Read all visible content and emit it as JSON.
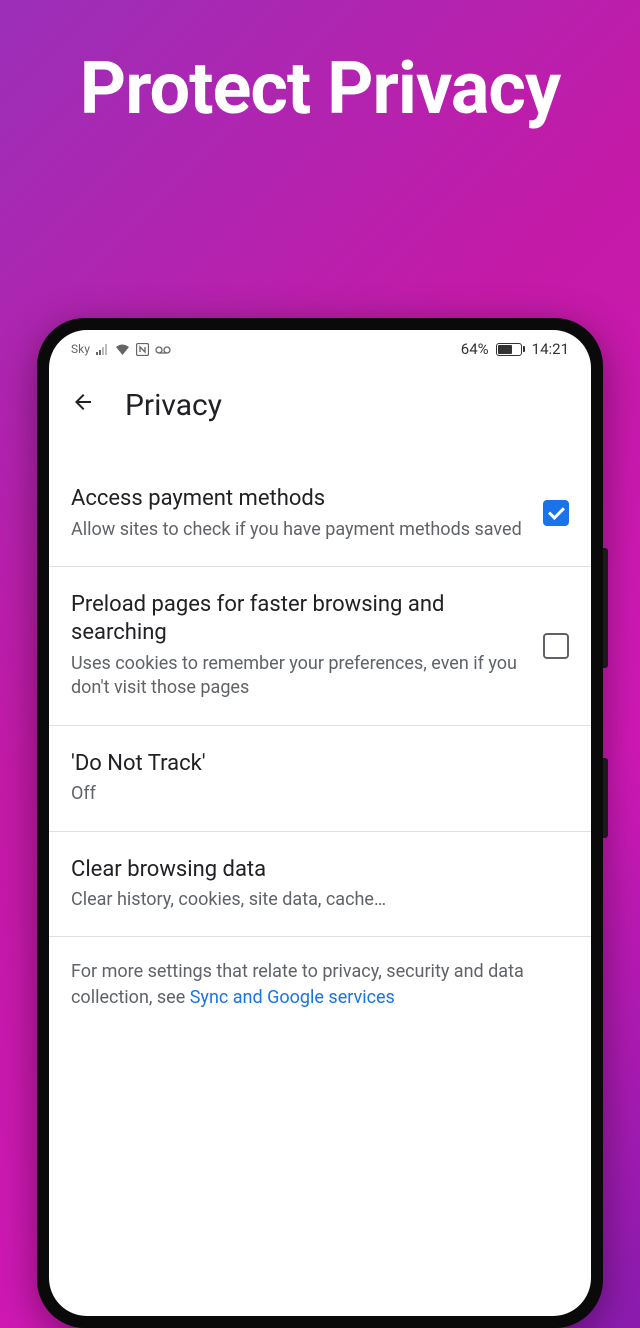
{
  "headline": "Protect Privacy",
  "status_bar": {
    "carrier": "Sky",
    "battery_pct": "64%",
    "time": "14:21"
  },
  "header": {
    "title": "Privacy"
  },
  "settings": [
    {
      "title": "Access payment methods",
      "subtitle": "Allow sites to check if you have payment methods saved",
      "checked": true,
      "has_checkbox": true
    },
    {
      "title": "Preload pages for faster browsing and searching",
      "subtitle": "Uses cookies to remember your preferences, even if you don't visit those pages",
      "checked": false,
      "has_checkbox": true
    },
    {
      "title": "'Do Not Track'",
      "subtitle": "Off",
      "has_checkbox": false
    },
    {
      "title": "Clear browsing data",
      "subtitle": "Clear history, cookies, site data, cache…",
      "has_checkbox": false
    }
  ],
  "footer": {
    "text_before": "For more settings that relate to privacy, security and data collection, see ",
    "link_text": "Sync and Google services"
  }
}
